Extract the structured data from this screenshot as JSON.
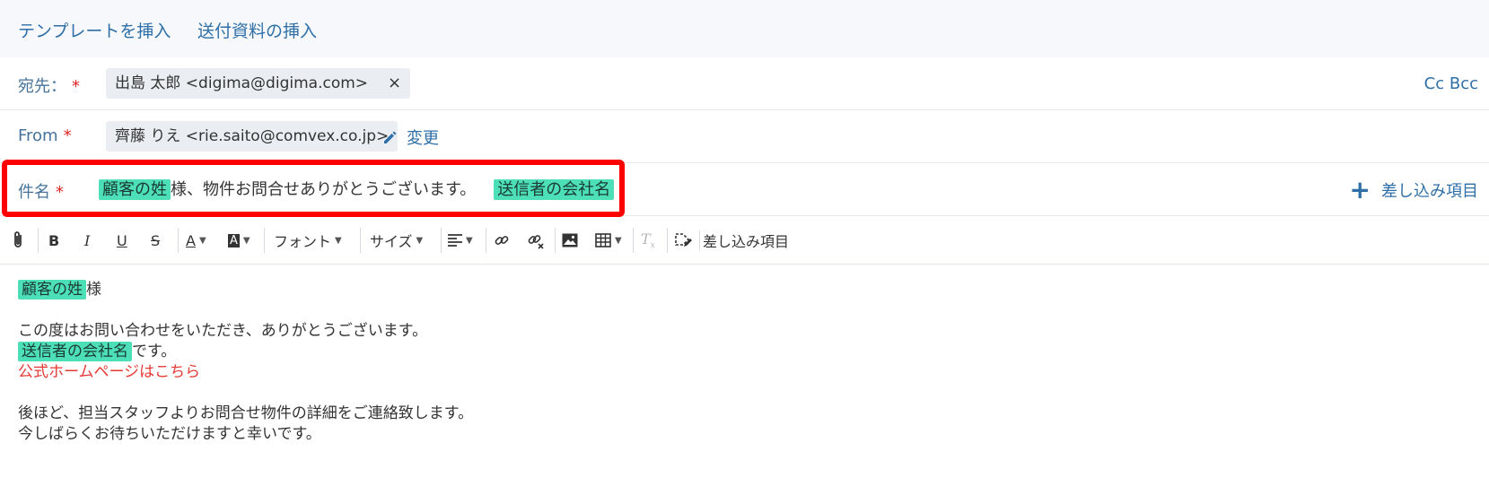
{
  "top_links": {
    "insert_template": "テンプレートを挿入",
    "insert_attachment": "送付資料の挿入"
  },
  "to_row": {
    "label": "宛先：",
    "required_mark": "*",
    "recipient": "出島 太郎 <digima@digima.com>",
    "remove_icon": "×",
    "cc_bcc": "Cc Bcc"
  },
  "from_row": {
    "label": "From",
    "required_mark": "*",
    "sender": "齊藤 りえ <rie.saito@comvex.co.jp>",
    "change_label": "変更"
  },
  "subject_row": {
    "label": "件名",
    "required_mark": "*",
    "tag1": "顧客の姓",
    "text": "様、物件お問合せありがとうございます。",
    "tag2": "送信者の会社名",
    "insert_field_label": "差し込み項目",
    "plus_icon": "+"
  },
  "toolbar": {
    "font_label": "フォント",
    "size_label": "サイズ",
    "insert_field_label": "差し込み項目"
  },
  "body": {
    "tag_customer": "顧客の姓",
    "greeting_suffix": "様",
    "line1": "この度はお問い合わせをいただき、ありがとうございます。",
    "tag_company": "送信者の会社名",
    "company_suffix": "です。",
    "homepage_link": "公式ホームページはこちら",
    "line4": "後ほど、担当スタッフよりお問合せ物件の詳細をご連絡致します。",
    "line5": "今しばらくお待ちいただけますと幸いです。"
  },
  "colors": {
    "accent_blue": "#2f6fa8",
    "tag_green": "#4ddfb7",
    "highlight_red": "#ff0000",
    "link_red": "#e53935"
  }
}
